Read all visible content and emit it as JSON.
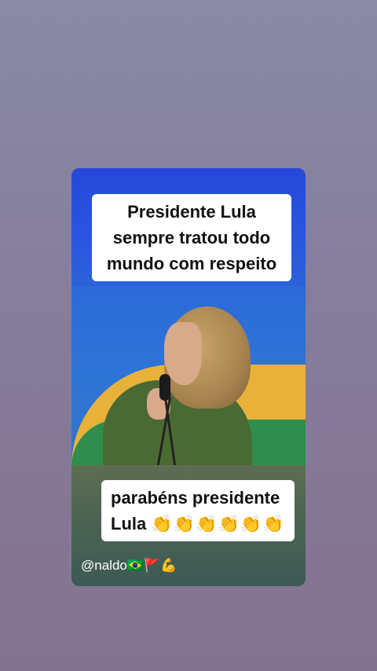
{
  "video": {
    "top_caption_lines": [
      "Presidente Lula",
      "sempre tratou todo",
      "mundo com respeito"
    ],
    "bottom_caption_lines": [
      "parabéns presidente",
      "Lula"
    ],
    "bottom_caption_emojis": "👏👏👏👏👏👏",
    "handle": "@naldo🇧🇷🚩💪"
  },
  "colors": {
    "background_top": "#8a8aa6",
    "background_bottom": "#84738f",
    "stage_blue": "#2a55e0",
    "stage_yellow": "#e8b23a",
    "stage_green": "#2f8e4d",
    "caption_bg": "#ffffff"
  }
}
